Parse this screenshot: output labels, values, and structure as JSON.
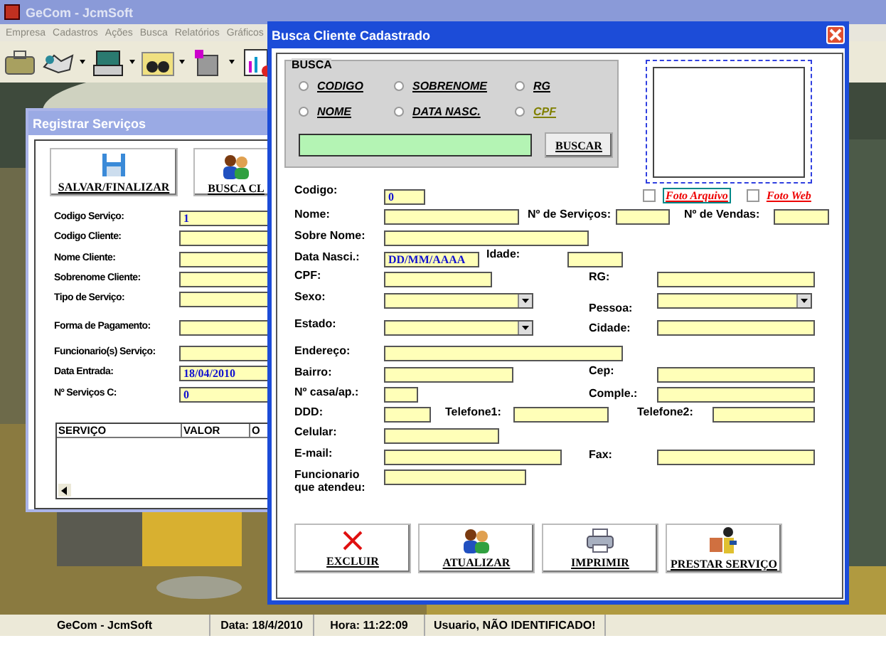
{
  "main_window": {
    "title": "GeCom - JcmSoft"
  },
  "menu": [
    {
      "label": "Empresa",
      "disabled": true
    },
    {
      "label": "Cadastros",
      "disabled": true
    },
    {
      "label": "Ações",
      "disabled": true
    },
    {
      "label": "Busca",
      "disabled": true
    },
    {
      "label": "Relatórios",
      "disabled": true
    },
    {
      "label": "Gráficos",
      "disabled": true
    }
  ],
  "services_window": {
    "title": "Registrar Serviços",
    "buttons": [
      "SALVAR/FINALIZAR",
      "BUSCA CL"
    ],
    "fields": [
      {
        "label": "Codigo Serviço:",
        "value": "1"
      },
      {
        "label": "Codigo Cliente:"
      },
      {
        "label": "Nome Cliente:"
      },
      {
        "label": "Sobrenome Cliente:"
      },
      {
        "label": "Tipo de Serviço:"
      },
      {
        "label": "Forma de Pagamento:"
      },
      {
        "label": "Funcionario(s) Serviço:"
      },
      {
        "label": "Data Entrada:",
        "value": "18/04/2010"
      },
      {
        "label": "Nº Serviços C:",
        "value": "0"
      }
    ],
    "table": {
      "columns": [
        "SERVIÇO",
        "VALOR",
        "O"
      ]
    }
  },
  "dialog": {
    "title": "Busca Cliente Cadastrado",
    "search": {
      "legend": "BUSCA",
      "button": "BUSCAR",
      "options": [
        {
          "label": "CODIGO",
          "selected": false,
          "color": "#000000"
        },
        {
          "label": "SOBRENOME",
          "selected": false,
          "color": "#000000"
        },
        {
          "label": "RG",
          "selected": false,
          "color": "#000000"
        },
        {
          "label": "NOME",
          "selected": false,
          "color": "#000000"
        },
        {
          "label": "DATA NASC.",
          "selected": false,
          "color": "#000000"
        },
        {
          "label": "CPF",
          "selected": false,
          "color": "#808000"
        }
      ]
    },
    "photo_options": [
      {
        "label": "Foto Arquivo",
        "checked": false
      },
      {
        "label": "Foto Web",
        "checked": false
      }
    ],
    "fields": [
      {
        "label": "Codigo:",
        "kind": "text",
        "value": "0"
      },
      {
        "label": "Nome:",
        "kind": "text"
      },
      {
        "label": "Nº de Serviços:",
        "kind": "text"
      },
      {
        "label": "Nº de Vendas:",
        "kind": "text"
      },
      {
        "label": "Sobre Nome:",
        "kind": "text"
      },
      {
        "label": "Data Nasci.:",
        "kind": "text",
        "value": "DD/MM/AAAA"
      },
      {
        "label": "Idade:",
        "kind": "text"
      },
      {
        "label": "CPF:",
        "kind": "text"
      },
      {
        "label": "RG:",
        "kind": "text"
      },
      {
        "label": "Sexo:",
        "kind": "combo"
      },
      {
        "label": "Pessoa:",
        "kind": "combo"
      },
      {
        "label": "Estado:",
        "kind": "combo"
      },
      {
        "label": "Cidade:",
        "kind": "text"
      },
      {
        "label": "Endereço:",
        "kind": "text"
      },
      {
        "label": "Bairro:",
        "kind": "text"
      },
      {
        "label": "Cep:",
        "kind": "text"
      },
      {
        "label": "Nº casa/ap.:",
        "kind": "text"
      },
      {
        "label": "Comple.:",
        "kind": "text"
      },
      {
        "label": "DDD:",
        "kind": "text"
      },
      {
        "label": "Telefone1:",
        "kind": "text"
      },
      {
        "label": "Telefone2:",
        "kind": "text"
      },
      {
        "label": "Celular:",
        "kind": "text"
      },
      {
        "label": "E-mail:",
        "kind": "text"
      },
      {
        "label": "Fax:",
        "kind": "text"
      },
      {
        "label": "Funcionario que atendeu:",
        "kind": "text"
      }
    ],
    "buttons": [
      "EXCLUIR",
      "ATUALIZAR",
      "IMPRIMIR",
      "PRESTAR SERVIÇO"
    ]
  },
  "status_bar": [
    "GeCom - JcmSoft",
    "Data: 18/4/2010",
    "Hora: 11:22:09",
    "Usuario, NÃO IDENTIFICADO!"
  ]
}
